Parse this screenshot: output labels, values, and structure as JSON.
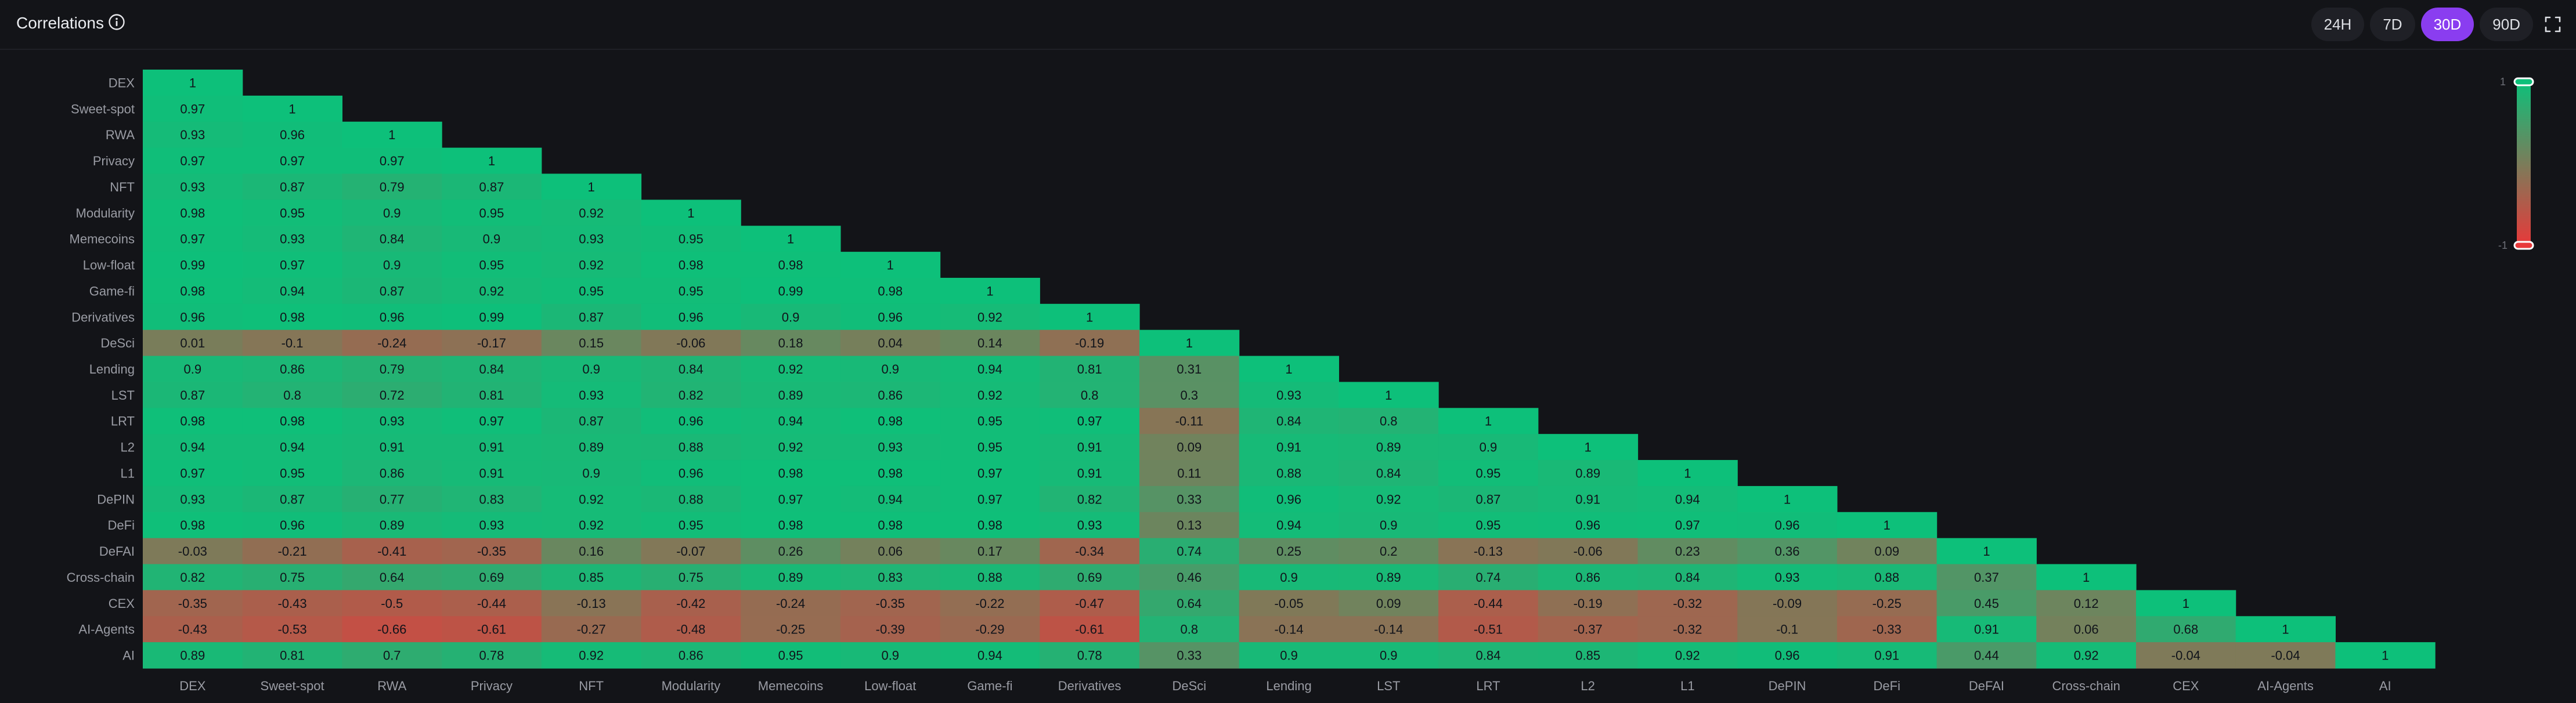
{
  "header": {
    "title": "Correlations",
    "info_icon": "info-icon",
    "periods": [
      "24H",
      "7D",
      "30D",
      "90D"
    ],
    "active_period": "30D",
    "expand_icon": "expand-icon"
  },
  "colors": {
    "background": "#131418",
    "positive": "#0dc07a",
    "negative": "#e8393a",
    "active_period": "#8a3df0"
  },
  "chart_data": {
    "type": "heatmap",
    "title": "",
    "rows": [
      "DEX",
      "Sweet-spot",
      "RWA",
      "Privacy",
      "NFT",
      "Modularity",
      "Memecoins",
      "Low-float",
      "Game-fi",
      "Derivatives",
      "DeSci",
      "Lending",
      "LST",
      "LRT",
      "L2",
      "L1",
      "DePIN",
      "DeFi",
      "DeFAI",
      "Cross-chain",
      "CEX",
      "AI-Agents",
      "AI"
    ],
    "columns": [
      "DEX",
      "Sweet-spot",
      "RWA",
      "Privacy",
      "NFT",
      "Modularity",
      "Memecoins",
      "Low-float",
      "Game-fi",
      "Derivatives",
      "DeSci",
      "Lending",
      "LST",
      "LRT",
      "L2",
      "L1",
      "DePIN",
      "DeFi",
      "DeFAI",
      "Cross-chain",
      "CEX",
      "AI-Agents",
      "AI"
    ],
    "values": [
      [
        "1"
      ],
      [
        "0.97",
        "1"
      ],
      [
        "0.93",
        "0.96",
        "1"
      ],
      [
        "0.97",
        "0.97",
        "0.97",
        "1"
      ],
      [
        "0.93",
        "0.87",
        "0.79",
        "0.87",
        "1"
      ],
      [
        "0.98",
        "0.95",
        "0.9",
        "0.95",
        "0.92",
        "1"
      ],
      [
        "0.97",
        "0.93",
        "0.84",
        "0.9",
        "0.93",
        "0.95",
        "1"
      ],
      [
        "0.99",
        "0.97",
        "0.9",
        "0.95",
        "0.92",
        "0.98",
        "0.98",
        "1"
      ],
      [
        "0.98",
        "0.94",
        "0.87",
        "0.92",
        "0.95",
        "0.95",
        "0.99",
        "0.98",
        "1"
      ],
      [
        "0.96",
        "0.98",
        "0.96",
        "0.99",
        "0.87",
        "0.96",
        "0.9",
        "0.96",
        "0.92",
        "1"
      ],
      [
        "0.01",
        "-0.1",
        "-0.24",
        "-0.17",
        "0.15",
        "-0.06",
        "0.18",
        "0.04",
        "0.14",
        "-0.19",
        "1"
      ],
      [
        "0.9",
        "0.86",
        "0.79",
        "0.84",
        "0.9",
        "0.84",
        "0.92",
        "0.9",
        "0.94",
        "0.81",
        "0.31",
        "1"
      ],
      [
        "0.87",
        "0.8",
        "0.72",
        "0.81",
        "0.93",
        "0.82",
        "0.89",
        "0.86",
        "0.92",
        "0.8",
        "0.3",
        "0.93",
        "1"
      ],
      [
        "0.98",
        "0.98",
        "0.93",
        "0.97",
        "0.87",
        "0.96",
        "0.94",
        "0.98",
        "0.95",
        "0.97",
        "-0.11",
        "0.84",
        "0.8",
        "1"
      ],
      [
        "0.94",
        "0.94",
        "0.91",
        "0.91",
        "0.89",
        "0.88",
        "0.92",
        "0.93",
        "0.95",
        "0.91",
        "0.09",
        "0.91",
        "0.89",
        "0.9",
        "1"
      ],
      [
        "0.97",
        "0.95",
        "0.86",
        "0.91",
        "0.9",
        "0.96",
        "0.98",
        "0.98",
        "0.97",
        "0.91",
        "0.11",
        "0.88",
        "0.84",
        "0.95",
        "0.89",
        "1"
      ],
      [
        "0.93",
        "0.87",
        "0.77",
        "0.83",
        "0.92",
        "0.88",
        "0.97",
        "0.94",
        "0.97",
        "0.82",
        "0.33",
        "0.96",
        "0.92",
        "0.87",
        "0.91",
        "0.94",
        "1"
      ],
      [
        "0.98",
        "0.96",
        "0.89",
        "0.93",
        "0.92",
        "0.95",
        "0.98",
        "0.98",
        "0.98",
        "0.93",
        "0.13",
        "0.94",
        "0.9",
        "0.95",
        "0.96",
        "0.97",
        "0.96",
        "1"
      ],
      [
        "-0.03",
        "-0.21",
        "-0.41",
        "-0.35",
        "0.16",
        "-0.07",
        "0.26",
        "0.06",
        "0.17",
        "-0.34",
        "0.74",
        "0.25",
        "0.2",
        "-0.13",
        "-0.06",
        "0.23",
        "0.36",
        "0.09",
        "1"
      ],
      [
        "0.82",
        "0.75",
        "0.64",
        "0.69",
        "0.85",
        "0.75",
        "0.89",
        "0.83",
        "0.88",
        "0.69",
        "0.46",
        "0.9",
        "0.89",
        "0.74",
        "0.86",
        "0.84",
        "0.93",
        "0.88",
        "0.37",
        "1"
      ],
      [
        "-0.35",
        "-0.43",
        "-0.5",
        "-0.44",
        "-0.13",
        "-0.42",
        "-0.24",
        "-0.35",
        "-0.22",
        "-0.47",
        "0.64",
        "-0.05",
        "0.09",
        "-0.44",
        "-0.19",
        "-0.32",
        "-0.09",
        "-0.25",
        "0.45",
        "0.12",
        "1"
      ],
      [
        "-0.43",
        "-0.53",
        "-0.66",
        "-0.61",
        "-0.27",
        "-0.48",
        "-0.25",
        "-0.39",
        "-0.29",
        "-0.61",
        "0.8",
        "-0.14",
        "-0.14",
        "-0.51",
        "-0.37",
        "-0.32",
        "-0.1",
        "-0.33",
        "0.91",
        "0.06",
        "0.68",
        "1"
      ],
      [
        "0.89",
        "0.81",
        "0.7",
        "0.78",
        "0.92",
        "0.86",
        "0.95",
        "0.9",
        "0.94",
        "0.78",
        "0.33",
        "0.9",
        "0.9",
        "0.84",
        "0.85",
        "0.92",
        "0.96",
        "0.91",
        "0.44",
        "0.92",
        "-0.04",
        "-0.04",
        "1"
      ]
    ],
    "scale": {
      "min": -1,
      "max": 1,
      "min_label": "-1",
      "max_label": "1"
    },
    "legend": "right"
  }
}
